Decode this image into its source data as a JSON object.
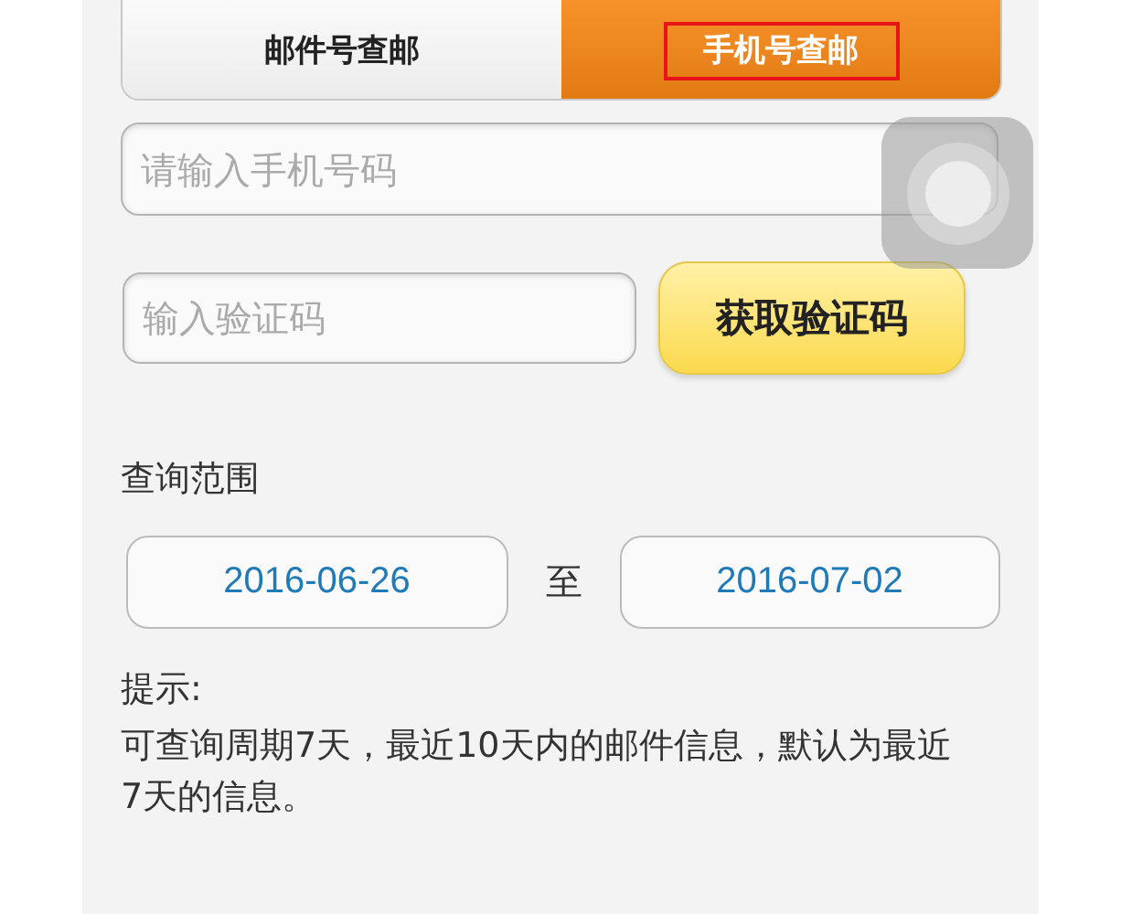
{
  "tabs": [
    {
      "label": "邮件号查邮",
      "selected": false,
      "highlighted": false
    },
    {
      "label": "手机号查邮",
      "selected": true,
      "highlighted": true
    }
  ],
  "phone_field": {
    "placeholder": "请输入手机号码"
  },
  "code_field": {
    "placeholder": "输入验证码"
  },
  "get_code_button": "获取验证码",
  "range": {
    "label": "查询范围",
    "start": "2016-06-26",
    "separator": "至",
    "end": "2016-07-02"
  },
  "hint": {
    "title": "提示:",
    "text": "可查询周期7天，最近10天内的邮件信息，默认为最近7天的信息。"
  }
}
